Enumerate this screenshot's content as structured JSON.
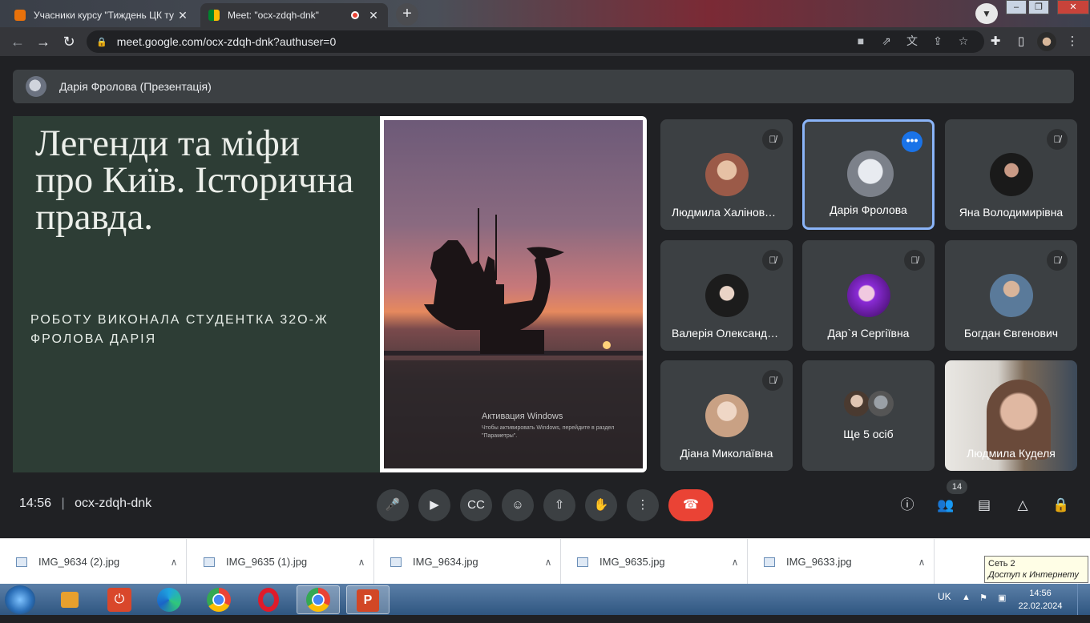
{
  "browser": {
    "tabs": [
      {
        "title": "Учасники курсу \"Тиждень ЦК ту",
        "close": "✕"
      },
      {
        "title": "Meet: \"ocx-zdqh-dnk\"",
        "close": "✕"
      }
    ],
    "new_tab": "+",
    "url": "meet.google.com/ocx-zdqh-dnk?authuser=0"
  },
  "meet": {
    "presenter_bar": "Дарія Фролова (Презентація)",
    "slide": {
      "title": "Легенди та міфи про Київ. Історична правда.",
      "subtitle": "РОБОТУ ВИКОНАЛА СТУДЕНТКА 32О-Ж ФРОЛОВА ДАРІЯ",
      "watermark_title": "Активация Windows",
      "watermark_text": "Чтобы активировать Windows, перейдите в раздел \"Параметры\"."
    },
    "participants": [
      {
        "name": "Людмила Халіновська",
        "muted": true,
        "avatar_color": "#9b5a48"
      },
      {
        "name": "Дарія Фролова",
        "muted": false,
        "active": true,
        "avatar_color": "#c3c7d0"
      },
      {
        "name": "Яна Володимирівна",
        "muted": true,
        "avatar_color": "#222222"
      },
      {
        "name": "Валерія Олександрівна",
        "muted": true,
        "avatar_color": "#1e1e1e"
      },
      {
        "name": "Дар`я Сергіївна",
        "muted": true,
        "avatar_color": "#8a2bd6"
      },
      {
        "name": "Богдан Євгенович",
        "muted": true,
        "avatar_color": "#5a7a9a"
      },
      {
        "name": "Діана Миколаївна",
        "muted": true,
        "avatar_color": "#c9a184"
      },
      {
        "name": "Ще 5 осіб",
        "muted": false,
        "avatar_color": "#555555"
      },
      {
        "name": "Людмила Куделя",
        "muted": false,
        "avatar_color": "#6a4a3a"
      }
    ],
    "time": "14:56",
    "meeting_code": "ocx-zdqh-dnk",
    "people_count": "14"
  },
  "downloads": [
    {
      "name": "IMG_9634 (2).jpg"
    },
    {
      "name": "IMG_9635 (1).jpg"
    },
    {
      "name": "IMG_9634.jpg"
    },
    {
      "name": "IMG_9635.jpg"
    },
    {
      "name": "IMG_9633.jpg"
    }
  ],
  "network_tooltip": {
    "line1": "Сеть  2",
    "line2": "Доступ к Интернету"
  },
  "taskbar": {
    "lang": "UK",
    "time": "14:56",
    "date": "22.02.2024"
  }
}
